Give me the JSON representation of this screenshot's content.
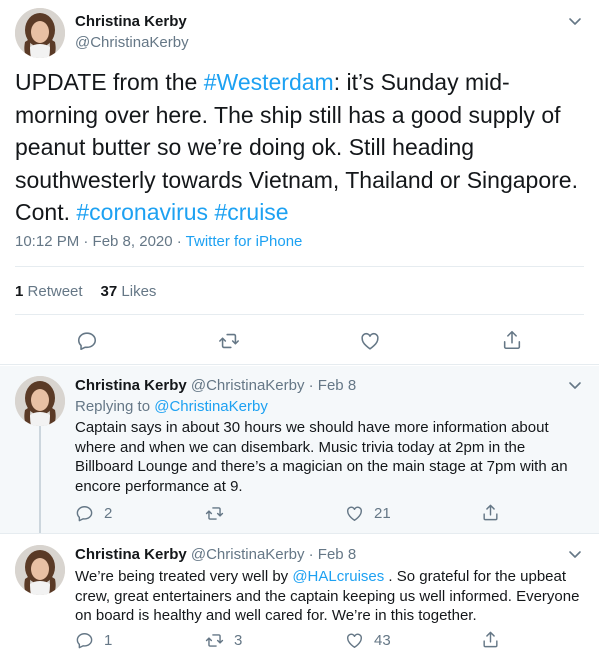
{
  "main_tweet": {
    "author_name": "Christina Kerby",
    "author_handle": "@ChristinaKerby",
    "text_segments": {
      "s1": "UPDATE from the ",
      "tag1": "#Westerdam",
      "s2": ": it’s Sunday mid-morning over here. The ship still has a good supply of peanut butter so we’re doing ok. Still heading southwesterly towards Vietnam, Thailand or Singapore. Cont. ",
      "tag2": "#coronavirus",
      "s3": " ",
      "tag3": "#cruise"
    },
    "timestamp": "10:12 PM · Feb 8, 2020 · ",
    "source": "Twitter for iPhone",
    "retweet_count": "1",
    "retweet_label": "Retweet",
    "like_count": "37",
    "like_label": "Likes",
    "icons": [
      "reply-icon",
      "retweet-icon",
      "like-icon",
      "share-icon",
      "chevron-down-icon"
    ]
  },
  "replies": [
    {
      "author_name": "Christina Kerby",
      "author_handle_date": "@ChristinaKerby · Feb 8",
      "replying_prefix": "Replying to ",
      "replying_handle": "@ChristinaKerby",
      "text": "Captain says in about 30 hours we should have more information about where and when we can disembark. Music trivia today at 2pm in the Billboard Lounge and there’s a magician on the main stage at 7pm with an encore performance at 9.",
      "reply_count": "2",
      "retweet_count": "",
      "like_count": "21"
    },
    {
      "author_name": "Christina Kerby",
      "author_handle_date": "@ChristinaKerby · Feb 8",
      "text_before": "We’re being treated very well by ",
      "mention": "@HALcruises",
      "text_after": " . So grateful for the upbeat crew, great entertainers and the captain keeping us well informed. Everyone on board is healthy and well cared for. We’re in this together.",
      "reply_count": "1",
      "retweet_count": "3",
      "like_count": "43"
    }
  ],
  "colors": {
    "link": "#1da1f2",
    "secondary_text": "#657786",
    "primary_text": "#14171a",
    "reply_background": "#f5f8fa",
    "divider": "#e6ecf0"
  }
}
